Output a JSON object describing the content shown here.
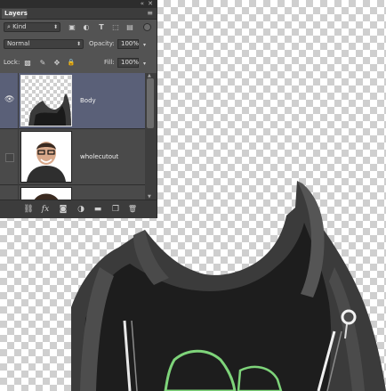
{
  "panel": {
    "collapse_icon": "double-chevron-left-icon",
    "collapse_glyph": "«",
    "close_glyph": "✕",
    "tab_label": "Layers",
    "menu_glyph": "≡",
    "filter": {
      "kind_icon": "search-icon",
      "kind_glyph": "⌕",
      "kind_label": "Kind",
      "icons": [
        {
          "name": "image-filter-icon",
          "glyph": "▣"
        },
        {
          "name": "adjustment-filter-icon",
          "glyph": "◐"
        },
        {
          "name": "type-filter-icon",
          "glyph": "T"
        },
        {
          "name": "shape-filter-icon",
          "glyph": "⬚"
        },
        {
          "name": "smart-object-filter-icon",
          "glyph": "▤"
        }
      ]
    },
    "blend_mode": "Normal",
    "opacity_label": "Opacity:",
    "opacity_value": "100%",
    "lock_label": "Lock:",
    "lock_icons": [
      {
        "name": "lock-transparent-pixels-icon",
        "glyph": "▩"
      },
      {
        "name": "lock-image-pixels-icon",
        "glyph": "✎"
      },
      {
        "name": "lock-position-icon",
        "glyph": "✥"
      },
      {
        "name": "lock-all-icon",
        "glyph": "🔒"
      }
    ],
    "fill_label": "Fill:",
    "fill_value": "100%",
    "layers": [
      {
        "name": "Body",
        "visible": true,
        "selected": true
      },
      {
        "name": "wholecutout",
        "visible": false,
        "selected": false
      },
      {
        "name": "",
        "visible": false,
        "selected": false
      }
    ],
    "bottom_icons": [
      {
        "name": "link-layers-icon",
        "glyph": "⛓"
      },
      {
        "name": "layer-style-fx-icon",
        "glyph": "fx"
      },
      {
        "name": "add-mask-icon",
        "glyph": "◙"
      },
      {
        "name": "adjustment-layer-icon",
        "glyph": "◑"
      },
      {
        "name": "new-group-icon",
        "glyph": "▬"
      },
      {
        "name": "new-layer-icon",
        "glyph": "❐"
      },
      {
        "name": "delete-layer-icon",
        "glyph": "🗑"
      }
    ]
  },
  "colors": {
    "panel_bg": "#535353",
    "selected_layer": "#5a6078",
    "hoodie": "#3a3a3a",
    "shirt": "#1c1c1c",
    "print": "#7ed47a"
  }
}
